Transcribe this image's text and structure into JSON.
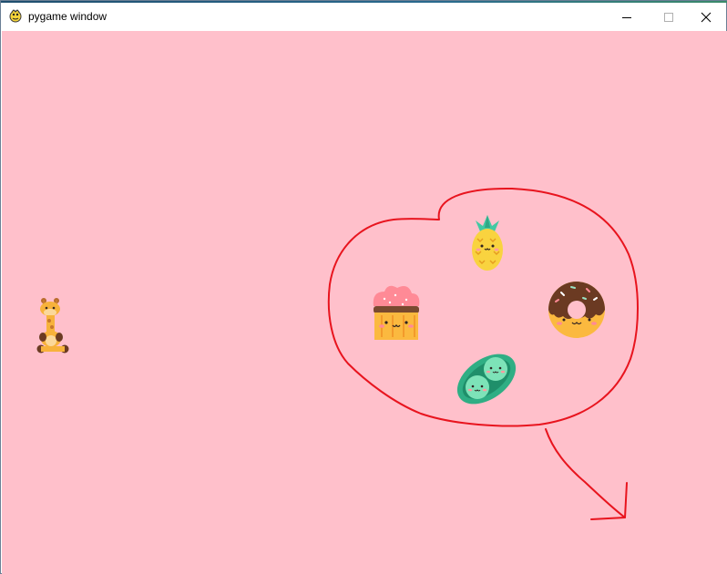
{
  "window": {
    "title": "pygame window",
    "controls": {
      "minimize": "minimize-icon",
      "maximize": "maximize-icon",
      "close": "close-icon"
    }
  },
  "game": {
    "background_color": "#ffc0cb",
    "annotation_color": "#e8141e",
    "sprites": [
      {
        "name": "giraffe",
        "icon": "giraffe-sprite"
      },
      {
        "name": "pineapple",
        "icon": "pineapple-sprite"
      },
      {
        "name": "cupcake",
        "icon": "cupcake-sprite"
      },
      {
        "name": "donut",
        "icon": "donut-sprite"
      },
      {
        "name": "peas",
        "icon": "peas-sprite"
      }
    ]
  }
}
